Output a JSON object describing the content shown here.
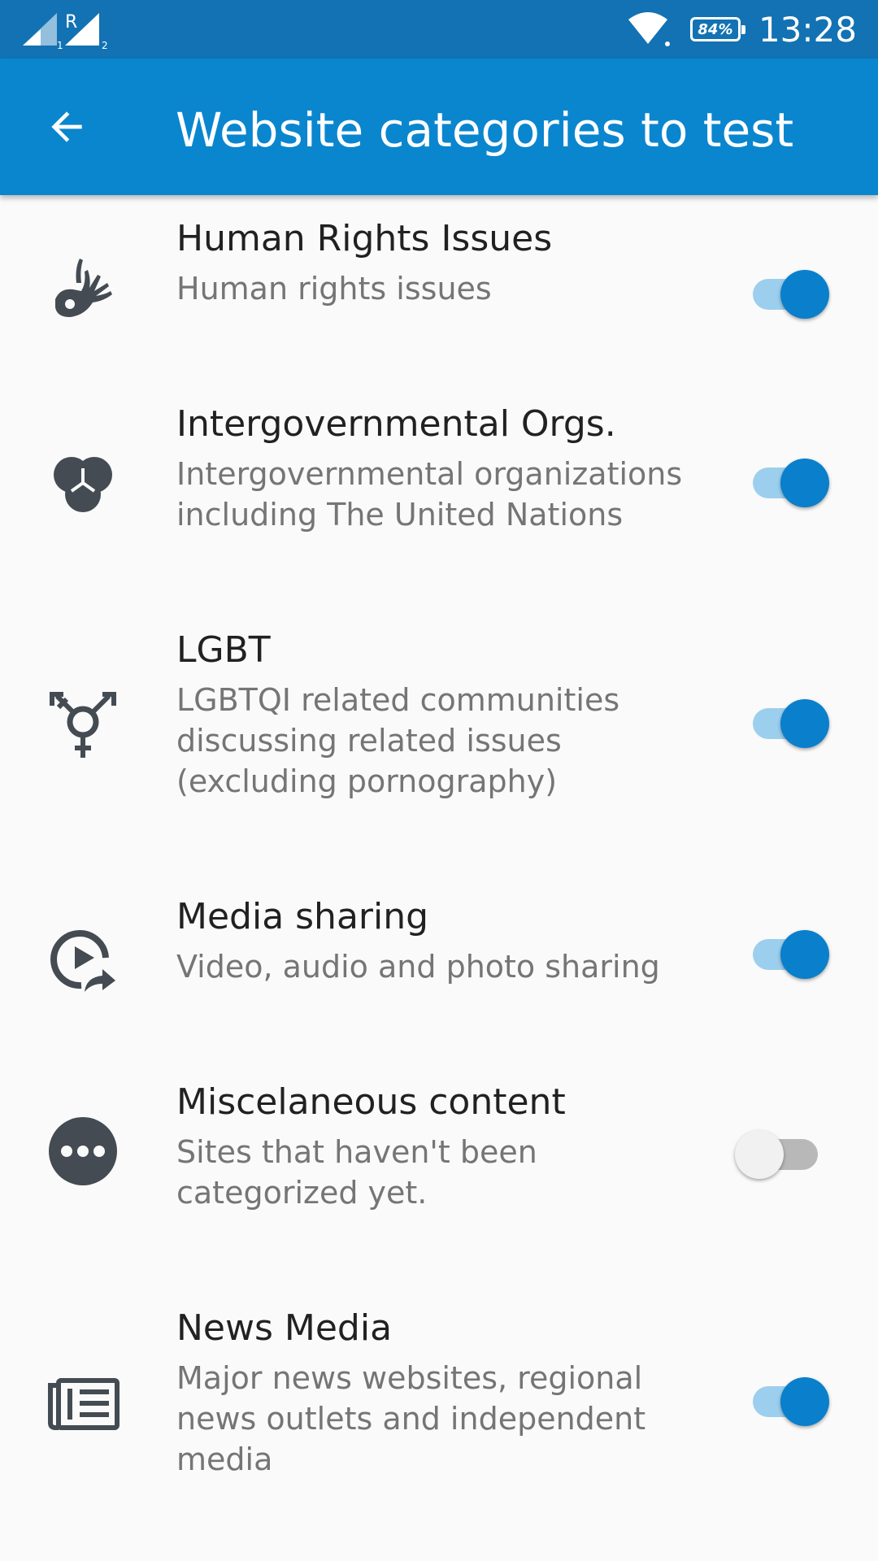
{
  "status_bar": {
    "battery": "84%",
    "time": "13:28",
    "sim1_label": "1",
    "sim2_label": "2",
    "roaming_label": "R"
  },
  "app_bar": {
    "title": "Website categories to test",
    "back_icon": "arrow-left-icon"
  },
  "colors": {
    "status_bar": "#1272b3",
    "app_bar": "#0a86cf",
    "accent": "#0a7fcc",
    "icon": "#444b52"
  },
  "categories": [
    {
      "title": "Human Rights Issues",
      "subtitle": "Human rights issues",
      "icon": "sign-language-hand-icon",
      "enabled": true
    },
    {
      "title": "Intergovernmental Orgs.",
      "subtitle": "Intergovernmental organizations including The United Nations",
      "icon": "three-circles-icon",
      "enabled": true
    },
    {
      "title": "LGBT",
      "subtitle": "LGBTQI related communities discussing related issues (excluding pornography)",
      "icon": "transgender-symbol-icon",
      "enabled": true
    },
    {
      "title": "Media sharing",
      "subtitle": "Video, audio and photo sharing",
      "icon": "play-share-icon",
      "enabled": true
    },
    {
      "title": "Miscelaneous content",
      "subtitle": "Sites that haven't been categorized yet.",
      "icon": "more-dots-icon",
      "enabled": false
    },
    {
      "title": "News Media",
      "subtitle": "Major news websites, regional news outlets and independent media",
      "icon": "newspaper-icon",
      "enabled": true
    }
  ]
}
